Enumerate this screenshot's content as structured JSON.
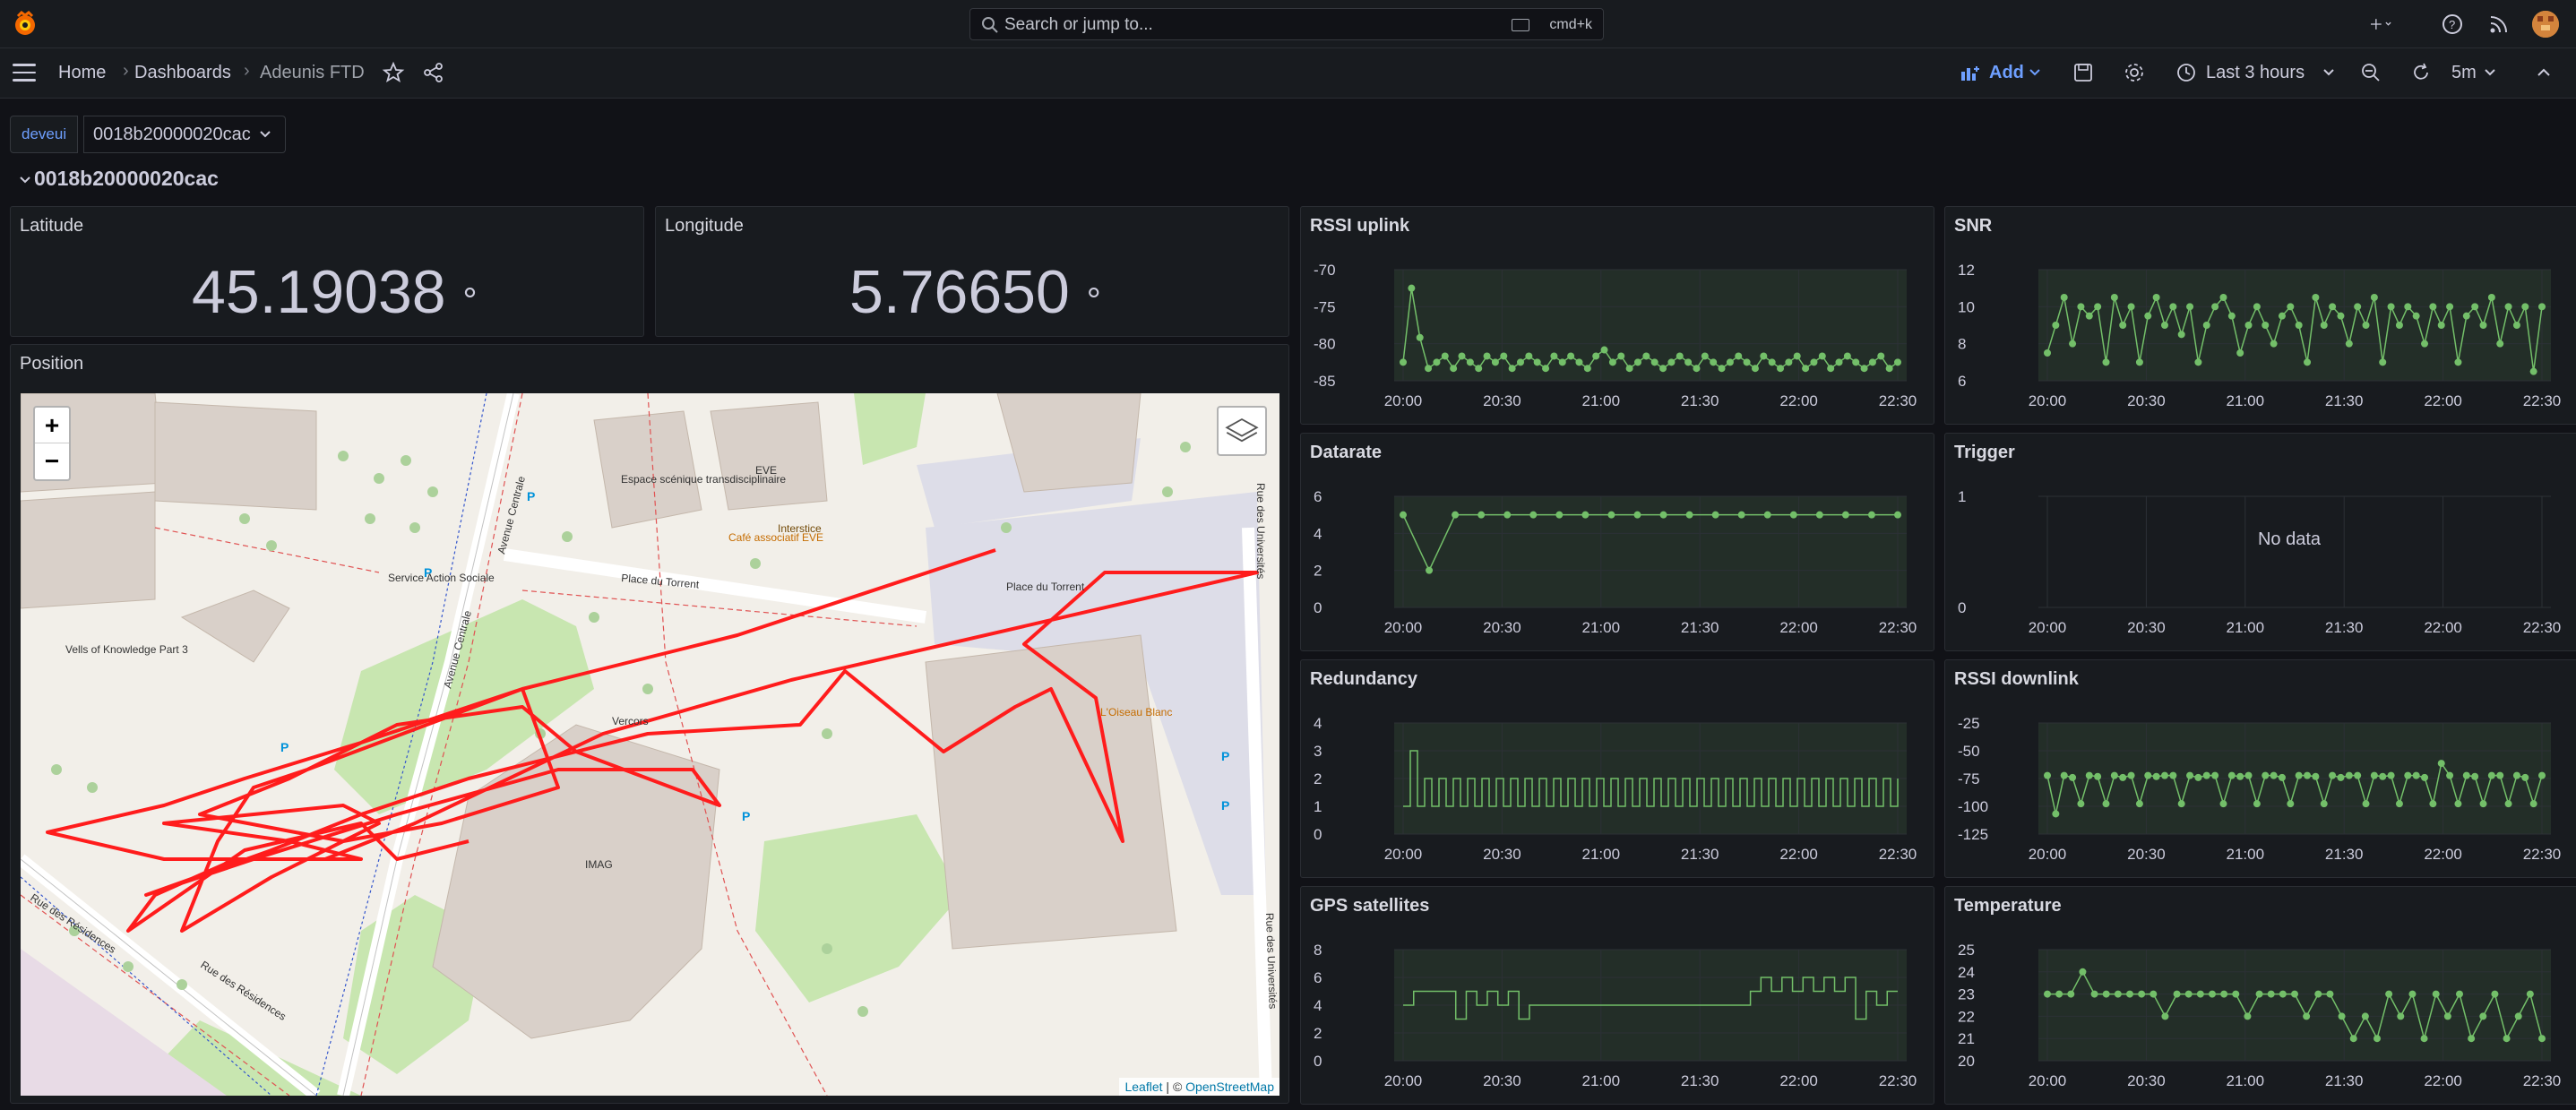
{
  "topbar": {
    "search_placeholder": "Search or jump to...",
    "search_shortcut": "cmd+k"
  },
  "nav": {
    "breadcrumb": [
      "Home",
      "Dashboards",
      "Adeunis FTD"
    ],
    "add_label": "Add",
    "time_range": "Last 3 hours",
    "refresh_interval": "5m"
  },
  "variables": {
    "label": "deveui",
    "value": "0018b20000020cac"
  },
  "row": {
    "title": "0018b20000020cac"
  },
  "stats": {
    "latitude": {
      "title": "Latitude",
      "value": "45.19038",
      "unit": "°"
    },
    "longitude": {
      "title": "Longitude",
      "value": "5.76650",
      "unit": "°"
    }
  },
  "map": {
    "title": "Position",
    "zoom_in": "+",
    "zoom_out": "−",
    "attribution_leaflet": "Leaflet",
    "attribution_sep": " | © ",
    "attribution_osm": "OpenStreetMap",
    "labels": [
      "Place du Torrent",
      "Place du Torrent",
      "Espace scénique transdisciplinaire",
      "EVE",
      "Avenue Centrale",
      "Avenue Centrale",
      "Rue des Résidences",
      "Rue des Résidences",
      "Rue des Universités",
      "Rue des Universités",
      "IMAG",
      "Vercors",
      "Service Action Sociale",
      "Vells of Knowledge Part 3",
      "Café associatif EVE",
      "Interstice",
      "L'Oiseau Blanc"
    ]
  },
  "time_ticks": [
    "20:00",
    "20:30",
    "21:00",
    "21:30",
    "22:00",
    "22:30"
  ],
  "accent_color": "#73bf69",
  "chart_data": [
    {
      "type": "line",
      "title": "RSSI uplink",
      "yticks": [
        "-70",
        "-75",
        "-80",
        "-85"
      ],
      "ylim": [
        -86,
        -68
      ],
      "series": [
        {
          "values": [
            -83,
            -71,
            -79,
            -84,
            -83,
            -82,
            -84,
            -82,
            -83,
            -84,
            -82,
            -83,
            -82,
            -84,
            -83,
            -82,
            -83,
            -84,
            -82,
            -83,
            -82,
            -83,
            -84,
            -82,
            -81,
            -83,
            -82,
            -84,
            -83,
            -82,
            -83,
            -84,
            -83,
            -82,
            -83,
            -84,
            -82,
            -83,
            -84,
            -83,
            -82,
            -83,
            -84,
            -82,
            -83,
            -84,
            -83,
            -82,
            -84,
            -83,
            -82,
            -84,
            -83,
            -82,
            -83,
            -84,
            -83,
            -82,
            -84,
            -83
          ]
        }
      ]
    },
    {
      "type": "line",
      "title": "SNR",
      "yticks": [
        "12",
        "10",
        "8",
        "6"
      ],
      "ylim": [
        6,
        12
      ],
      "series": [
        {
          "values": [
            7.5,
            9,
            10.5,
            8,
            10,
            9.5,
            10,
            7,
            10.5,
            9,
            10,
            7,
            9.5,
            10.5,
            9,
            10,
            8.5,
            10,
            7,
            9,
            10,
            10.5,
            9.5,
            7.5,
            9,
            10,
            9,
            8,
            9.5,
            10,
            9,
            7,
            10.5,
            9,
            10,
            9.5,
            8,
            10,
            9,
            10.5,
            7,
            10,
            9,
            10,
            9.5,
            8,
            10,
            9,
            10,
            7,
            9.5,
            10,
            9,
            10.5,
            8,
            10,
            9,
            10,
            6.5,
            10
          ]
        }
      ]
    },
    {
      "type": "line",
      "title": "Datarate",
      "yticks": [
        "6",
        "4",
        "2",
        "0"
      ],
      "ylim": [
        0,
        6
      ],
      "series": [
        {
          "values": [
            5,
            2,
            5,
            5,
            5,
            5,
            5,
            5,
            5,
            5,
            5,
            5,
            5,
            5,
            5,
            5,
            5,
            5,
            5,
            5
          ]
        }
      ]
    },
    {
      "type": "line",
      "title": "Trigger",
      "yticks": [
        "1",
        "0"
      ],
      "no_data": "No data"
    },
    {
      "type": "line",
      "title": "Redundancy",
      "yticks": [
        "4",
        "3",
        "2",
        "1",
        "0"
      ],
      "ylim": [
        0,
        4
      ],
      "series": [
        {
          "values": [
            1,
            3,
            1,
            2,
            1,
            2,
            1,
            2,
            1,
            2,
            1,
            2,
            1,
            2,
            1,
            2,
            1,
            2,
            1,
            2,
            1,
            2,
            1,
            2,
            1,
            2,
            1,
            2,
            1,
            2,
            1,
            2,
            1,
            2,
            1,
            2,
            1,
            2,
            1,
            2,
            1,
            2,
            1,
            2,
            1,
            2,
            1,
            2,
            1,
            2,
            1,
            2,
            1,
            2,
            1,
            2,
            1,
            2,
            1,
            2,
            1,
            2,
            1,
            2,
            1,
            2,
            1,
            2,
            1,
            2
          ]
        }
      ]
    },
    {
      "type": "line",
      "title": "RSSI downlink",
      "yticks": [
        "-25",
        "-50",
        "-75",
        "-100",
        "-125"
      ],
      "ylim": [
        -130,
        -20
      ],
      "series": [
        {
          "values": [
            -72,
            -110,
            -72,
            -74,
            -100,
            -72,
            -73,
            -100,
            -72,
            -74,
            -72,
            -100,
            -72,
            -73,
            -72,
            -72,
            -100,
            -72,
            -74,
            -72,
            -72,
            -100,
            -72,
            -73,
            -72,
            -100,
            -72,
            -72,
            -74,
            -100,
            -72,
            -72,
            -73,
            -100,
            -72,
            -74,
            -72,
            -72,
            -100,
            -72,
            -73,
            -72,
            -100,
            -72,
            -72,
            -74,
            -100,
            -60,
            -72,
            -100,
            -72,
            -73,
            -100,
            -72,
            -72,
            -100,
            -72,
            -74,
            -100,
            -72
          ]
        }
      ]
    },
    {
      "type": "line",
      "title": "GPS satellites",
      "yticks": [
        "8",
        "6",
        "4",
        "2",
        "0"
      ],
      "ylim": [
        0,
        8
      ],
      "series": [
        {
          "values": [
            4,
            5,
            5,
            5,
            5,
            3,
            5,
            4,
            5,
            4,
            5,
            3,
            4,
            4,
            4,
            4,
            4,
            4,
            4,
            4,
            4,
            4,
            4,
            4,
            4,
            4,
            4,
            4,
            4,
            4,
            4,
            4,
            4,
            5,
            6,
            5,
            6,
            5,
            6,
            5,
            6,
            5,
            6,
            3,
            5,
            4,
            5,
            5
          ]
        }
      ]
    },
    {
      "type": "line",
      "title": "Temperature",
      "yticks": [
        "25",
        "24",
        "23",
        "22",
        "21",
        "20"
      ],
      "ylim": [
        20,
        25
      ],
      "series": [
        {
          "values": [
            23,
            23,
            23,
            24,
            23,
            23,
            23,
            23,
            23,
            23,
            22,
            23,
            23,
            23,
            23,
            23,
            23,
            22,
            23,
            23,
            23,
            23,
            22,
            23,
            23,
            22,
            21,
            22,
            21,
            23,
            22,
            23,
            21,
            23,
            22,
            23,
            21,
            22,
            23,
            21,
            22,
            23,
            21
          ]
        }
      ]
    }
  ]
}
